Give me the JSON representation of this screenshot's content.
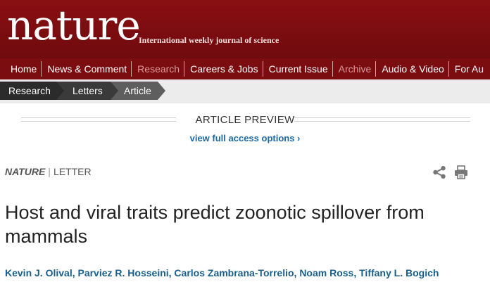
{
  "masthead": {
    "logo": "nature",
    "tagline": "International weekly journal of science"
  },
  "nav": {
    "items": [
      {
        "label": "Home"
      },
      {
        "label": "News & Comment"
      },
      {
        "label": "Research"
      },
      {
        "label": "Careers & Jobs"
      },
      {
        "label": "Current Issue"
      },
      {
        "label": "Archive"
      },
      {
        "label": "Audio & Video"
      },
      {
        "label": "For Au"
      }
    ]
  },
  "breadcrumb": [
    "Research",
    "Letters",
    "Article"
  ],
  "preview": {
    "title": "ARTICLE PREVIEW",
    "link": "view full access options ›"
  },
  "article": {
    "journal": "NATURE",
    "separator": "|",
    "type": "LETTER",
    "title": "Host and viral traits predict zoonotic spillover from mammals",
    "authors": "Kevin J. Olival, Parviez R. Hosseini, Carlos Zambrana-Torrelio, Noam Ross, Tiffany L. Bogich"
  },
  "icons": {
    "share": "share-icon",
    "print": "print-icon"
  },
  "colors": {
    "brand": "#7b0d10",
    "link": "#1a6aa5",
    "author": "#1a5e8a"
  }
}
